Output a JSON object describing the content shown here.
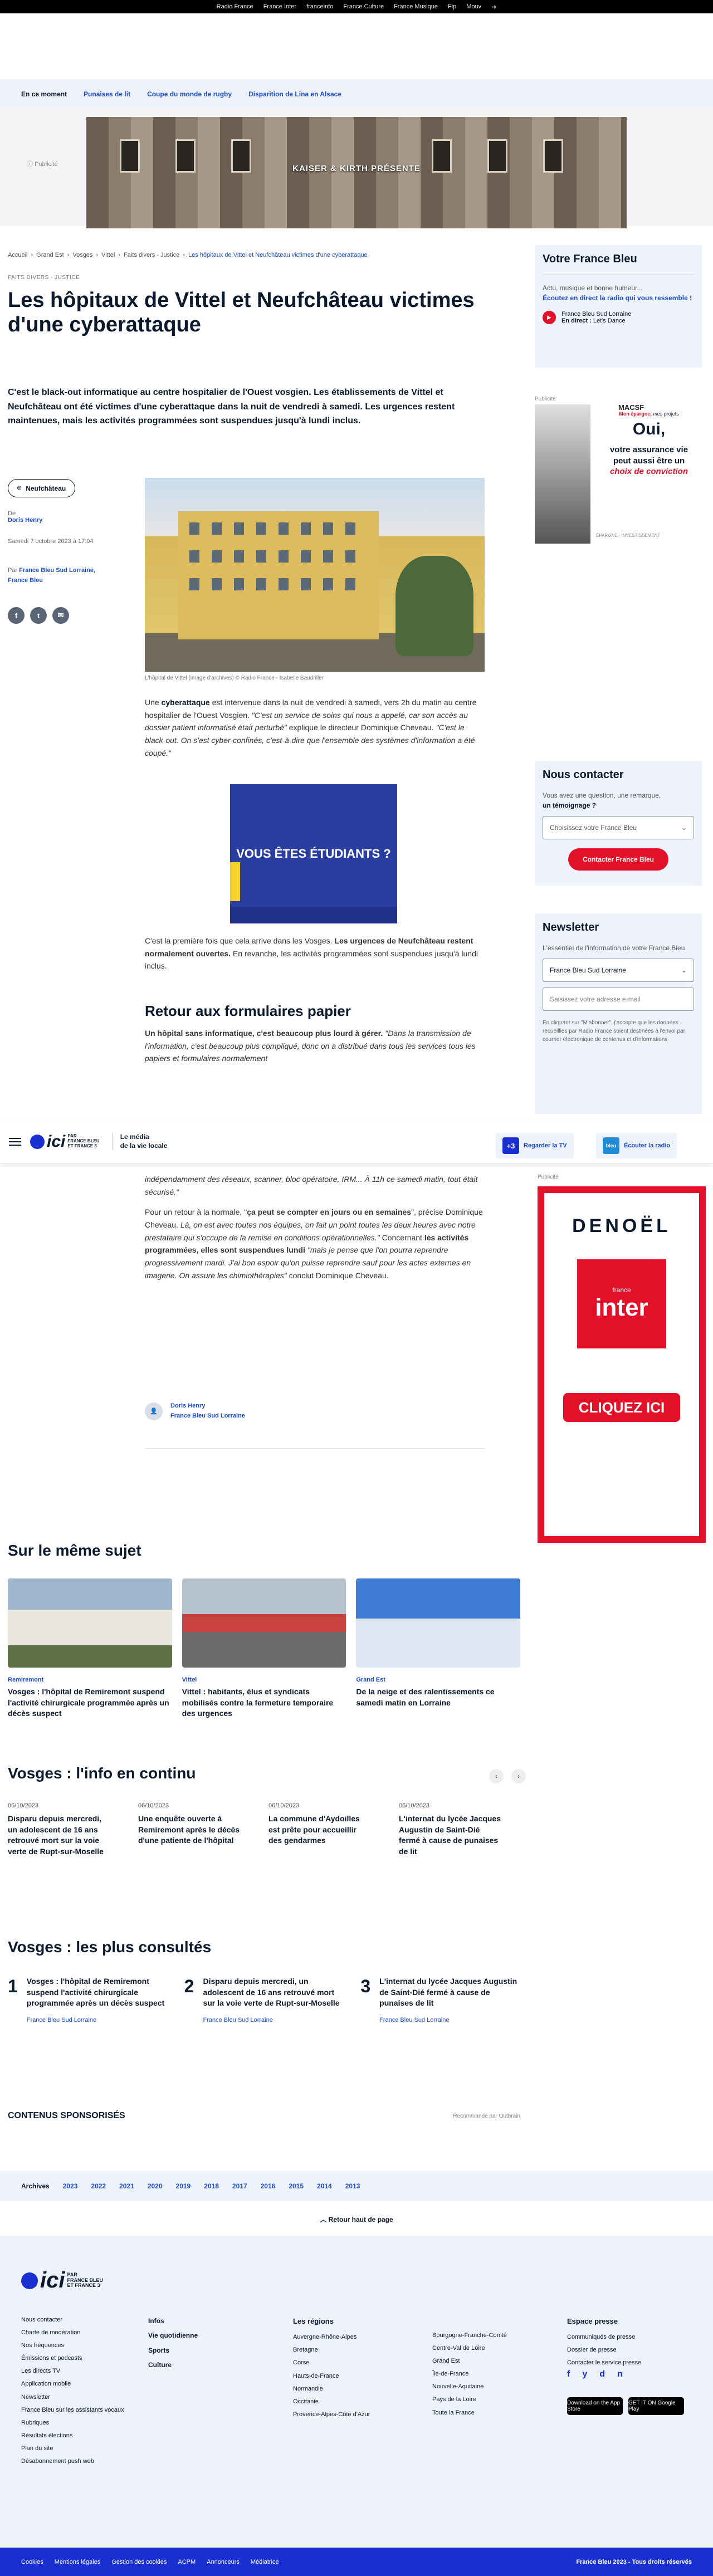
{
  "topbar": [
    "Radio France",
    "France Inter",
    "franceinfo",
    "France Culture",
    "France Musique",
    "Fip",
    "Mouv"
  ],
  "trending": {
    "label": "En ce moment",
    "links": [
      "Punaises de lit",
      "Coupe du monde de rugby",
      "Disparition de Lina en Alsace"
    ]
  },
  "ad_banner": {
    "label": "Publicité",
    "text": "KAISER & KIRTH PRÉSENTE"
  },
  "breadcrumb": [
    "Accueil",
    "Grand Est",
    "Vosges",
    "Vittel",
    "Faits divers - Justice",
    "Les hôpitaux de Vittel et Neufchâteau victimes d'une cyberattaque"
  ],
  "article": {
    "tags": "FAITS DIVERS - JUSTICE",
    "title": "Les hôpitaux de Vittel et Neufchâteau victimes d'une cyberattaque",
    "chapo": "C'est le black-out informatique au centre hospitalier de l'Ouest vosgien. Les établissements de Vittel et Neufchâteau ont été victimes d'une cyberattaque dans la nuit de vendredi à samedi. Les urgences restent maintenues, mais les activités programmées sont suspendues jusqu'à lundi inclus.",
    "location": "Neufchâteau",
    "author_prefix": "De",
    "author": "Doris Henry",
    "date": "Samedi 7 octobre 2023 à 17:04",
    "par_prefix": "Par",
    "par_station": "France Bleu Sud Lorraine,",
    "par_station2": "France Bleu",
    "caption": "L'hôpital de Vittel (image d'archives) © Radio France - Isabelle Baudriller",
    "p1_a": "Une",
    "p1_b": "cyberattaque",
    "p1_c": "est intervenue dans la nuit de vendredi à samedi, vers 2h du matin au centre hospitalier de l'Ouest Vosgien.",
    "p1_d": "\"C'est un service de soins qui nous a appelé, car son accès au dossier patient informatisé était perturbé\"",
    "p1_e": "explique le directeur Dominique Cheveau.",
    "p1_f": "\"C'est le black-out. On s'est cyber-confinés, c'est-à-dire que l'ensemble des systèmes d'information a été coupé.\"",
    "promo": "VOUS ÊTES ÉTUDIANTS ?",
    "p2_a": "C'est la première fois que cela arrive dans les Vosges.",
    "p2_b": "Les urgences de Neufchâteau restent normalement ouvertes.",
    "p2_c": "En revanche, les activités programmées sont suspendues jusqu'à lundi inclus.",
    "h2": "Retour aux formulaires papier",
    "p3_a": "Un hôpital sans informatique, c'est beaucoup plus lourd à gérer.",
    "p3_b": "\"Dans la transmission de l'information, c'est beaucoup plus compliqué, donc on a distribué dans tous les services tous les papiers et formulaires normalement",
    "p4_a": "indépendamment des réseaux, scanner, bloc opératoire, IRM... À 11h ce samedi matin, tout était sécurisé.\"",
    "p5_a": "Pour un retour à la normale, \"",
    "p5_b": "ça peut se compter en jours ou en semaines",
    "p5_c": "\", précise Dominique Cheveau.",
    "p5_d": "Là, on est avec toutes nos équipes, on fait un point toutes les deux heures avec notre prestataire qui s'occupe de la remise en conditions opérationnelles.\"",
    "p5_e": "Concernant",
    "p5_f": "les activités programmées, elles sont suspendues lundi",
    "p5_g": "\"mais je pense que l'on pourra reprendre progressivement mardi. J'ai bon espoir qu'on puisse reprendre sauf pour les actes externes en imagerie. On assure les chimiothérapies\"",
    "p5_h": "conclut Dominique Cheveau.",
    "authorbox_name": "Doris Henry",
    "authorbox_station": "France Bleu Sud Lorraine"
  },
  "sticky": {
    "logo": "ici",
    "logo_sub1": "PAR",
    "logo_sub2": "FRANCE BLEU",
    "logo_sub3": "ET FRANCE 3",
    "motto1": "Le média",
    "motto2": "de la vie locale",
    "tv_badge": "+3",
    "tv_label": "Regarder la TV",
    "radio_badge": "bleu",
    "radio_label": "Écouter la radio"
  },
  "right": {
    "vfb_title": "Votre France Bleu",
    "vfb_now": "Actu, musique et bonne humeur...",
    "vfb_listen": "Écoutez en direct la radio qui vous ressemble !",
    "vfb_station": "France Bleu Sud Lorraine",
    "vfb_live_prefix": "En direct :",
    "vfb_live": "Let's Dance",
    "pub": "Publicité",
    "ad_brand": "MACSF",
    "ad_tag1": "Mon épargne,",
    "ad_tag2": "mes projets",
    "ad_oui": "Oui,",
    "ad_line1": "votre assurance vie",
    "ad_line2": "peut aussi être un",
    "ad_line3": "choix de conviction",
    "ad_foot": "ÉPARGNE · INVESTISSEMENT",
    "contact_title": "Nous contacter",
    "contact_text1": "Vous avez une question, une remarque,",
    "contact_text2": "un témoignage ?",
    "contact_select": "Choisissez votre France Bleu",
    "contact_btn": "Contacter France Bleu",
    "nl_title": "Newsletter",
    "nl_text": "L'essentiel de l'information de votre France Bleu.",
    "nl_select": "France Bleu Sud Lorraine",
    "nl_input": "Saisissez votre adresse e-mail",
    "nl_legal": "En cliquant sur \"M'abonner\", j'accepte que les données recueillies par Radio France soient destinées à l'envoi par courrier électronique de contenus et d'informations"
  },
  "interad": {
    "pub": "Publicité",
    "brand": "DENOËL",
    "france": "france",
    "inter": "inter",
    "cta": "CLIQUEZ ICI"
  },
  "same_subject": {
    "title": "Sur le même sujet",
    "items": [
      {
        "tag": "Remiremont",
        "title": "Vosges : l'hôpital de Remiremont suspend l'activité chirurgicale programmée après un décès suspect"
      },
      {
        "tag": "Vittel",
        "title": "Vittel : habitants, élus et syndicats mobilisés contre la fermeture temporaire des urgences"
      },
      {
        "tag": "Grand Est",
        "title": "De la neige et des ralentissements ce samedi matin en Lorraine"
      }
    ]
  },
  "feed": {
    "title": "Vosges : l'info en continu",
    "items": [
      {
        "date": "06/10/2023",
        "title": "Disparu depuis mercredi, un adolescent de 16 ans retrouvé mort sur la voie verte de Rupt-sur-Moselle"
      },
      {
        "date": "06/10/2023",
        "title": "Une enquête ouverte à Remiremont après le décès d'une patiente de l'hôpital"
      },
      {
        "date": "06/10/2023",
        "title": "La commune d'Aydoilles est prête pour accueillir des gendarmes"
      },
      {
        "date": "06/10/2023",
        "title": "L'internat du lycée Jacques Augustin de Saint-Dié fermé à cause de punaises de lit"
      }
    ]
  },
  "most_read": {
    "title": "Vosges : les plus consultés",
    "items": [
      {
        "num": "1",
        "title": "Vosges : l'hôpital de Remiremont suspend l'activité chirurgicale programmée après un décès suspect",
        "station": "France Bleu Sud Lorraine"
      },
      {
        "num": "2",
        "title": "Disparu depuis mercredi, un adolescent de 16 ans retrouvé mort sur la voie verte de Rupt-sur-Moselle",
        "station": "France Bleu Sud Lorraine"
      },
      {
        "num": "3",
        "title": "L'internat du lycée Jacques Augustin de Saint-Dié fermé à cause de punaises de lit",
        "station": "France Bleu Sud Lorraine"
      }
    ]
  },
  "sponso": {
    "title": "CONTENUS SPONSORISÉS",
    "by": "Recommandé par Outbrain"
  },
  "archives": {
    "label": "Archives",
    "years": [
      "2023",
      "2022",
      "2021",
      "2020",
      "2019",
      "2018",
      "2017",
      "2016",
      "2015",
      "2014",
      "2013"
    ]
  },
  "backtop": "Retour haut de page",
  "footer": {
    "col1": [
      "Nous contacter",
      "Charte de modération",
      "Nos fréquences",
      "Émissions et podcasts",
      "Les directs TV",
      "Application mobile",
      "Newsletter",
      "France Bleu sur les assistants vocaux",
      "Rubriques",
      "Résultats élections",
      "Plan du site",
      "Désabonnement push web"
    ],
    "col2": [
      "Infos",
      "Vie quotidienne",
      "Sports",
      "Culture"
    ],
    "regions_title": "Les régions",
    "col3": [
      "Auvergne-Rhône-Alpes",
      "Bretagne",
      "Corse",
      "Hauts-de-France",
      "Normandie",
      "Occitanie",
      "Provence-Alpes-Côte d'Azur"
    ],
    "col4": [
      "Bourgogne-Franche-Comté",
      "Centre-Val de Loire",
      "Grand Est",
      "Île-de-France",
      "Nouvelle-Aquitaine",
      "Pays de la Loire",
      "Toute la France"
    ],
    "press_title": "Espace presse",
    "col5": [
      "Communiqués de presse",
      "Dossier de presse",
      "Contacter le service presse"
    ],
    "social": [
      "f",
      "y",
      "d",
      "n"
    ],
    "store1": "Download on the App Store",
    "store2": "GET IT ON Google Play"
  },
  "bottombar": {
    "links": [
      "Cookies",
      "Mentions légales",
      "Gestion des cookies",
      "ACPM",
      "Annonceurs",
      "Médiatrice"
    ],
    "copy": "France Bleu 2023 - Tous droits réservés"
  },
  "colors": {
    "accent": "#1a4ccf",
    "brand": "#1a2fd0",
    "red": "#e3102a"
  }
}
